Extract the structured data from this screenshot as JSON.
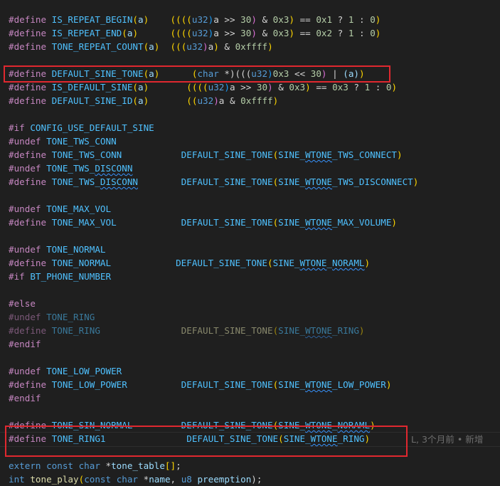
{
  "editor": {
    "background": "#1f1f1f",
    "highlight_color": "#e0282f",
    "blame_text": "L, 3个月前 • 新增",
    "lines": [
      {
        "inactive": false,
        "tokens": [
          [
            "#define ",
            "dir"
          ],
          [
            "IS_REPEAT_BEGIN",
            "mac"
          ],
          [
            "(",
            "p1"
          ],
          [
            "a",
            "par"
          ],
          [
            ")",
            "p1"
          ],
          [
            "    ",
            "txt"
          ],
          [
            "((((",
            "p1"
          ],
          [
            "u32",
            "kw"
          ],
          [
            ")",
            "p3"
          ],
          [
            "a >> ",
            "txt"
          ],
          [
            "30",
            "num"
          ],
          [
            ")",
            "p2"
          ],
          [
            " & ",
            "txt"
          ],
          [
            "0x3",
            "num"
          ],
          [
            ")",
            "p1"
          ],
          [
            " == ",
            "txt"
          ],
          [
            "0x1",
            "num"
          ],
          [
            " ? ",
            "txt"
          ],
          [
            "1",
            "num"
          ],
          [
            " : ",
            "txt"
          ],
          [
            "0",
            "num"
          ],
          [
            ")",
            "p1"
          ]
        ]
      },
      {
        "inactive": false,
        "tokens": [
          [
            "#define ",
            "dir"
          ],
          [
            "IS_REPEAT_END",
            "mac"
          ],
          [
            "(",
            "p1"
          ],
          [
            "a",
            "par"
          ],
          [
            ")",
            "p1"
          ],
          [
            "      ",
            "txt"
          ],
          [
            "((((",
            "p1"
          ],
          [
            "u32",
            "kw"
          ],
          [
            ")",
            "p3"
          ],
          [
            "a >> ",
            "txt"
          ],
          [
            "30",
            "num"
          ],
          [
            ")",
            "p2"
          ],
          [
            " & ",
            "txt"
          ],
          [
            "0x3",
            "num"
          ],
          [
            ")",
            "p1"
          ],
          [
            " == ",
            "txt"
          ],
          [
            "0x2",
            "num"
          ],
          [
            " ? ",
            "txt"
          ],
          [
            "1",
            "num"
          ],
          [
            " : ",
            "txt"
          ],
          [
            "0",
            "num"
          ],
          [
            ")",
            "p1"
          ]
        ]
      },
      {
        "inactive": false,
        "tokens": [
          [
            "#define ",
            "dir"
          ],
          [
            "TONE_REPEAT_COUNT",
            "mac"
          ],
          [
            "(",
            "p1"
          ],
          [
            "a",
            "par"
          ],
          [
            ")",
            "p1"
          ],
          [
            "  ",
            "txt"
          ],
          [
            "(((",
            "p1"
          ],
          [
            "u32",
            "kw"
          ],
          [
            ")",
            "p2"
          ],
          [
            "a",
            "txt"
          ],
          [
            ")",
            "p1"
          ],
          [
            " & ",
            "txt"
          ],
          [
            "0xffff",
            "num"
          ],
          [
            ")",
            "p1"
          ]
        ]
      },
      {
        "inactive": false,
        "tokens": []
      },
      {
        "inactive": false,
        "tokens": [
          [
            "#define ",
            "dir"
          ],
          [
            "DEFAULT_SINE_TONE",
            "mac"
          ],
          [
            "(",
            "p1"
          ],
          [
            "a",
            "par"
          ],
          [
            ")",
            "p1"
          ],
          [
            "      ",
            "txt"
          ],
          [
            "(",
            "p1"
          ],
          [
            "char",
            "kw"
          ],
          [
            " *)(((",
            "txt"
          ],
          [
            "u32",
            "kw"
          ],
          [
            ")",
            "p3"
          ],
          [
            "0x3",
            "num"
          ],
          [
            " << ",
            "txt"
          ],
          [
            "30",
            "num"
          ],
          [
            ")",
            "p2"
          ],
          [
            " | ",
            "txt"
          ],
          [
            "(a)",
            "par"
          ],
          [
            ")",
            "p1"
          ]
        ]
      },
      {
        "inactive": false,
        "tokens": [
          [
            "#define ",
            "dir"
          ],
          [
            "IS_DEFAULT_SINE",
            "mac"
          ],
          [
            "(",
            "p1"
          ],
          [
            "a",
            "par"
          ],
          [
            ")",
            "p1"
          ],
          [
            "       ",
            "txt"
          ],
          [
            "((((",
            "p1"
          ],
          [
            "u32",
            "kw"
          ],
          [
            ")",
            "p3"
          ],
          [
            "a >> ",
            "txt"
          ],
          [
            "30",
            "num"
          ],
          [
            ")",
            "p2"
          ],
          [
            " & ",
            "txt"
          ],
          [
            "0x3",
            "num"
          ],
          [
            ")",
            "p1"
          ],
          [
            " == ",
            "txt"
          ],
          [
            "0x3",
            "num"
          ],
          [
            " ? ",
            "txt"
          ],
          [
            "1",
            "num"
          ],
          [
            " : ",
            "txt"
          ],
          [
            "0",
            "num"
          ],
          [
            ")",
            "p1"
          ]
        ]
      },
      {
        "inactive": false,
        "tokens": [
          [
            "#define ",
            "dir"
          ],
          [
            "DEFAULT_SINE_ID",
            "mac"
          ],
          [
            "(",
            "p1"
          ],
          [
            "a",
            "par"
          ],
          [
            ")",
            "p1"
          ],
          [
            "       ",
            "txt"
          ],
          [
            "((",
            "p1"
          ],
          [
            "u32",
            "kw"
          ],
          [
            ")",
            "p2"
          ],
          [
            "a & ",
            "txt"
          ],
          [
            "0xffff",
            "num"
          ],
          [
            ")",
            "p1"
          ]
        ]
      },
      {
        "inactive": false,
        "tokens": []
      },
      {
        "inactive": false,
        "tokens": [
          [
            "#if ",
            "dir"
          ],
          [
            "CONFIG_USE_DEFAULT_SINE",
            "mac"
          ]
        ]
      },
      {
        "inactive": false,
        "tokens": [
          [
            "#undef ",
            "dir"
          ],
          [
            "TONE_TWS_CONN",
            "mac"
          ]
        ]
      },
      {
        "inactive": false,
        "tokens": [
          [
            "#define ",
            "dir"
          ],
          [
            "TONE_TWS_CONN",
            "mac"
          ],
          [
            "           ",
            "txt"
          ],
          [
            "DEFAULT_SINE_TONE",
            "mac"
          ],
          [
            "(",
            "p1"
          ],
          [
            "SINE_",
            "mac"
          ],
          [
            "WTONE",
            "mac",
            "squig"
          ],
          [
            "_TWS_CONNECT",
            "mac"
          ],
          [
            ")",
            "p1"
          ]
        ]
      },
      {
        "inactive": false,
        "tokens": [
          [
            "#undef ",
            "dir"
          ],
          [
            "TONE_TWS_",
            "mac"
          ],
          [
            "DISCONN",
            "mac",
            "squig"
          ]
        ]
      },
      {
        "inactive": false,
        "tokens": [
          [
            "#define ",
            "dir"
          ],
          [
            "TONE_TWS_",
            "mac"
          ],
          [
            "DISCONN",
            "mac",
            "squig"
          ],
          [
            "        ",
            "txt"
          ],
          [
            "DEFAULT_SINE_TONE",
            "mac"
          ],
          [
            "(",
            "p1"
          ],
          [
            "SINE_",
            "mac"
          ],
          [
            "WTONE",
            "mac",
            "squig"
          ],
          [
            "_TWS_DISCONNECT",
            "mac"
          ],
          [
            ")",
            "p1"
          ]
        ]
      },
      {
        "inactive": false,
        "tokens": []
      },
      {
        "inactive": false,
        "tokens": [
          [
            "#undef ",
            "dir"
          ],
          [
            "TONE_MAX_VOL",
            "mac"
          ]
        ]
      },
      {
        "inactive": false,
        "tokens": [
          [
            "#define ",
            "dir"
          ],
          [
            "TONE_MAX_VOL",
            "mac"
          ],
          [
            "            ",
            "txt"
          ],
          [
            "DEFAULT_SINE_TONE",
            "mac"
          ],
          [
            "(",
            "p1"
          ],
          [
            "SINE_",
            "mac"
          ],
          [
            "WTONE",
            "mac",
            "squig"
          ],
          [
            "_MAX_VOLUME",
            "mac"
          ],
          [
            ")",
            "p1"
          ]
        ]
      },
      {
        "inactive": false,
        "tokens": []
      },
      {
        "inactive": false,
        "tokens": [
          [
            "#undef ",
            "dir"
          ],
          [
            "TONE_NORMAL",
            "mac"
          ]
        ]
      },
      {
        "inactive": false,
        "tokens": [
          [
            "#define ",
            "dir"
          ],
          [
            "TONE_NORMAL",
            "mac"
          ],
          [
            "            ",
            "txt"
          ],
          [
            "DEFAULT_SINE_TONE",
            "mac"
          ],
          [
            "(",
            "p1"
          ],
          [
            "SINE_",
            "mac"
          ],
          [
            "WTONE",
            "mac",
            "squig"
          ],
          [
            "_",
            "mac"
          ],
          [
            "NORAML",
            "mac",
            "squig"
          ],
          [
            ")",
            "p1"
          ]
        ]
      },
      {
        "inactive": false,
        "tokens": [
          [
            "#if ",
            "dir"
          ],
          [
            "BT_PHONE_NUMBER",
            "mac"
          ]
        ]
      },
      {
        "inactive": false,
        "tokens": []
      },
      {
        "inactive": false,
        "tokens": [
          [
            "#else",
            "dir"
          ]
        ]
      },
      {
        "inactive": true,
        "tokens": [
          [
            "#undef ",
            "dir"
          ],
          [
            "TONE_RING",
            "mac"
          ]
        ]
      },
      {
        "inactive": true,
        "tokens": [
          [
            "#define ",
            "dir"
          ],
          [
            "TONE_RING",
            "mac"
          ],
          [
            "               ",
            "txt"
          ],
          [
            "DEFAULT_SINE_TONE",
            "fn"
          ],
          [
            "(",
            "p1"
          ],
          [
            "SINE_",
            "mac"
          ],
          [
            "WTONE",
            "mac",
            "squig"
          ],
          [
            "_RING",
            "mac"
          ],
          [
            ")",
            "p1"
          ]
        ]
      },
      {
        "inactive": false,
        "tokens": [
          [
            "#endif",
            "dir"
          ]
        ]
      },
      {
        "inactive": false,
        "tokens": []
      },
      {
        "inactive": false,
        "tokens": [
          [
            "#undef ",
            "dir"
          ],
          [
            "TONE_LOW_POWER",
            "mac"
          ]
        ]
      },
      {
        "inactive": false,
        "tokens": [
          [
            "#define ",
            "dir"
          ],
          [
            "TONE_LOW_POWER",
            "mac"
          ],
          [
            "          ",
            "txt"
          ],
          [
            "DEFAULT_SINE_TONE",
            "mac"
          ],
          [
            "(",
            "p1"
          ],
          [
            "SINE_",
            "mac"
          ],
          [
            "WTONE",
            "mac",
            "squig"
          ],
          [
            "_LOW_POWER",
            "mac"
          ],
          [
            ")",
            "p1"
          ]
        ]
      },
      {
        "inactive": false,
        "tokens": [
          [
            "#endif",
            "dir"
          ]
        ]
      },
      {
        "inactive": false,
        "tokens": []
      },
      {
        "inactive": false,
        "tokens": [
          [
            "#define ",
            "dir"
          ],
          [
            "TONE_SIN_NORMAL",
            "mac"
          ],
          [
            "         ",
            "txt"
          ],
          [
            "DEFAULT_SINE_TONE",
            "mac"
          ],
          [
            "(",
            "p1"
          ],
          [
            "SINE_",
            "mac"
          ],
          [
            "WTONE",
            "mac",
            "squig"
          ],
          [
            "_",
            "mac"
          ],
          [
            "NORAML",
            "mac",
            "squig"
          ],
          [
            ")",
            "p1"
          ]
        ]
      },
      {
        "inactive": false,
        "tokens": [
          [
            "#define ",
            "dir"
          ],
          [
            "TONE_RING1",
            "mac"
          ],
          [
            "               ",
            "txt"
          ],
          [
            "DEFAULT_SINE_TONE",
            "mac"
          ],
          [
            "(",
            "p1"
          ],
          [
            "SINE_",
            "mac"
          ],
          [
            "WTONE",
            "mac",
            "squig"
          ],
          [
            "_RING",
            "mac"
          ],
          [
            ")",
            "p1"
          ]
        ]
      },
      {
        "inactive": false,
        "tokens": []
      },
      {
        "inactive": false,
        "tokens": [
          [
            "extern ",
            "kw"
          ],
          [
            "const ",
            "kw"
          ],
          [
            "char ",
            "kw"
          ],
          [
            "*",
            "txt"
          ],
          [
            "tone_table",
            "par"
          ],
          [
            "[]",
            "p1"
          ],
          [
            ";",
            "txt"
          ]
        ]
      },
      {
        "inactive": false,
        "tokens": [
          [
            "int ",
            "kw"
          ],
          [
            "tone_play",
            "fn"
          ],
          [
            "(",
            "p1"
          ],
          [
            "const ",
            "kw"
          ],
          [
            "char ",
            "kw"
          ],
          [
            "*",
            "txt"
          ],
          [
            "name",
            "par"
          ],
          [
            ", ",
            "txt"
          ],
          [
            "u8 ",
            "kw"
          ],
          [
            "preemption",
            "par"
          ],
          [
            ");",
            "txt"
          ]
        ]
      }
    ]
  }
}
